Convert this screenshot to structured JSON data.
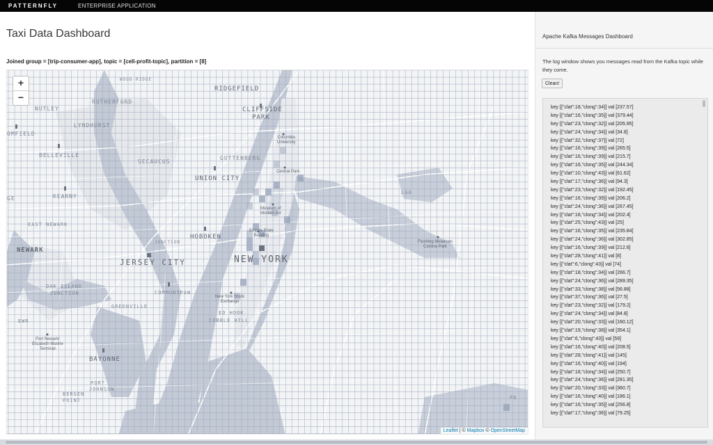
{
  "header": {
    "brand": "PATTERNFLY",
    "subtitle": "ENTERPRISE APPLICATION"
  },
  "dashboard": {
    "title": "Taxi Data Dashboard",
    "joined_info": "Joined group = [trip-consumer-app], topic = [cell-profit-topic], partition = [8]"
  },
  "map": {
    "zoom_in": "+",
    "zoom_out": "−",
    "attribution": {
      "leaflet": "Leaflet",
      "sep1": " | © ",
      "mapbox": "Mapbox",
      "sep2": " © ",
      "osm": "OpenStreetMap"
    },
    "labels": {
      "wood_ridge": "WOOD-RIDGE",
      "ridgefield": "RIDGEFIELD",
      "nutley": "NUTLEY",
      "rutherford": "RUTHERFORD",
      "cliffside1": "CLIFFSIDE",
      "cliffside2": "PARK",
      "bloomfield": "OMFIELD",
      "lyndhurst": "LYNDHURST",
      "belleville": "BELLEVILLE",
      "secaucus": "SECAUCUS",
      "guttenberg": "GUTTENBERG",
      "union_city": "UNION CITY",
      "kearny": "KEARNY",
      "ge": "GE",
      "east_newark": "EAST NEWARK",
      "newark": "NEWARK",
      "hoboken": "HOBOKEN",
      "junction": "JUNCTION",
      "jersey_city": "JERSEY CITY",
      "new_york": "NEW YORK",
      "oak_island1": "OAK ISLAND",
      "oak_island2": "JUNCTION",
      "communipaw": "COMMUNIPAW",
      "greenville": "GREENVILLE",
      "ewr": "EWR",
      "bayonne": "BAYONNE",
      "port_johnson1": "PORT",
      "port_johnson2": "JOHNSON",
      "bergen_point1": "BERGEN",
      "bergen_point2": "POINT",
      "lga": "LGA",
      "redhook": "ED HOOK",
      "cobble": "COBBLE HILL",
      "fk": "FK"
    },
    "pois": {
      "columbia": "Columbia\nUniversity",
      "central_park": "Central Park",
      "museum": "Museum of\nModern Art",
      "empire": "Empire State\nBuilding",
      "nyse": "New York Stock\nExchange",
      "flushing": "Flushing Meadows\nCorona Park",
      "port_newark": "Port Newark/\nElizabeth Marine\nTerminal"
    }
  },
  "kafka": {
    "title": "Apache Kafka Messages Dashboard",
    "description": "The log window shows you messages read from the Kafka topic while they come.",
    "clean_button": "Clean!",
    "messages": [
      "key [{\"clat\":18,\"clong\":34}] val [237.57]",
      "key [{\"clat\":16,\"clong\":35}] val [379.44]",
      "key [{\"clat\":23,\"clong\":32}] val [205.95]",
      "key [{\"clat\":24,\"clong\":34}] val [34.8]",
      "key [{\"clat\":32,\"clong\":37}] val [72]",
      "key [{\"clat\":16,\"clong\":39}] val [265.5]",
      "key [{\"clat\":16,\"clong\":39}] val [215.7]",
      "key [{\"clat\":16,\"clong\":35}] val [244.34]",
      "key [{\"clat\":10,\"clong\":43}] val [61.62]",
      "key [{\"clat\":17,\"clong\":36}] val [94.3]",
      "key [{\"clat\":23,\"clong\":32}] val [192.45]",
      "key [{\"clat\":16,\"clong\":39}] val [206.2]",
      "key [{\"clat\":24,\"clong\":36}] val [267.45]",
      "key [{\"clat\":18,\"clong\":34}] val [202.4]",
      "key [{\"clat\":25,\"clong\":43}] val [25]",
      "key [{\"clat\":16,\"clong\":35}] val [235.84]",
      "key [{\"clat\":24,\"clong\":36}] val [302.85]",
      "key [{\"clat\":16,\"clong\":39}] val [212.6]",
      "key [{\"clat\":28,\"clong\":41}] val [8]",
      "key [{\"clat\":6,\"clong\":43}] val [74]",
      "key [{\"clat\":18,\"clong\":34}] val [266.7]",
      "key [{\"clat\":24,\"clong\":36}] val [289.35]",
      "key [{\"clat\":33,\"clong\":38}] val [56.88]",
      "key [{\"clat\":37,\"clong\":36}] val [27.5]",
      "key [{\"clat\":23,\"clong\":32}] val [179.2]",
      "key [{\"clat\":24,\"clong\":34}] val [84.8]",
      "key [{\"clat\":20,\"clong\":33}] val [160.12]",
      "key [{\"clat\":19,\"clong\":38}] val [354.1]",
      "key [{\"clat\":6,\"clong\":43}] val [59]",
      "key [{\"clat\":16,\"clong\":40}] val [208.5]",
      "key [{\"clat\":28,\"clong\":41}] val [145]",
      "key [{\"clat\":16,\"clong\":40}] val [194]",
      "key [{\"clat\":18,\"clong\":34}] val [250.7]",
      "key [{\"clat\":24,\"clong\":36}] val [281.35]",
      "key [{\"clat\":20,\"clong\":33}] val [360.7]",
      "key [{\"clat\":16,\"clong\":40}] val [186.1]",
      "key [{\"clat\":16,\"clong\":35}] val [256.8]",
      "key [{\"clat\":17,\"clong\":36}] val [79.25]"
    ]
  }
}
